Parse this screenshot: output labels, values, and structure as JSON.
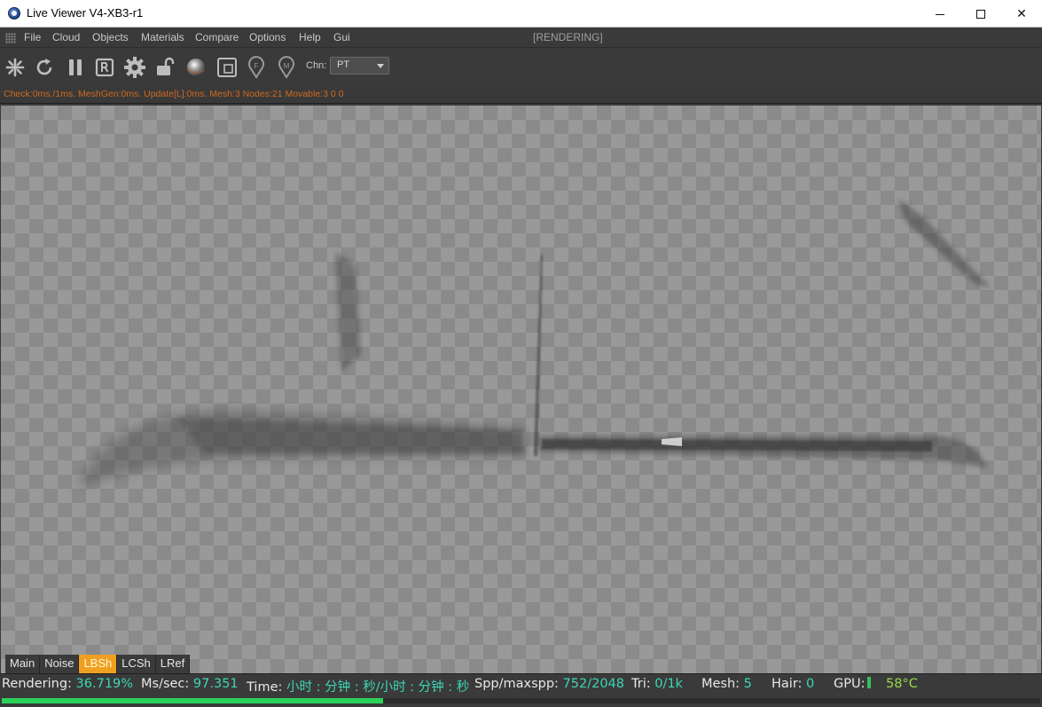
{
  "window": {
    "title": "Live Viewer V4-XB3-r1",
    "controls": {
      "minimize_icon": "minimize-icon",
      "maximize_icon": "maximize-icon",
      "close_glyph": "✕"
    }
  },
  "menu": {
    "items": [
      "File",
      "Cloud",
      "Objects",
      "Materials",
      "Compare",
      "Options",
      "Help",
      "Gui"
    ],
    "status": "[RENDERING]"
  },
  "toolbar": {
    "icons": [
      "send-scene-icon",
      "restart-icon",
      "pause-icon",
      "region-render-icon",
      "settings-gear-icon",
      "lock-icon",
      "material-ball-icon",
      "film-region-icon",
      "focus-pick-icon",
      "material-pick-icon"
    ],
    "channel_label": "Chn:",
    "channel_value": "PT"
  },
  "stats_line": "Check:0ms./1ms. MeshGen:0ms. Update[L]:0ms. Mesh:3 Nodes:21 Movable:3  0 0",
  "tabs": [
    {
      "label": "Main",
      "active": false
    },
    {
      "label": "Noise",
      "active": false
    },
    {
      "label": "LBSh",
      "active": true
    },
    {
      "label": "LCSh",
      "active": false
    },
    {
      "label": "LRef",
      "active": false
    }
  ],
  "status": {
    "rendering_label": "Rendering:",
    "rendering_value": "36.719%",
    "mssec_label": "Ms/sec:",
    "mssec_value": "97.351",
    "time_label": "Time:",
    "time_value": "小时 : 分钟 : 秒/小时 : 分钟 : 秒",
    "spp_label": "Spp/maxspp:",
    "spp_value": "752/2048",
    "tri_label": "Tri:",
    "tri_value": "0/1k",
    "mesh_label": "Mesh:",
    "mesh_value": "5",
    "hair_label": "Hair:",
    "hair_value": "0",
    "gpu_label": "GPU:",
    "gpu_temp": "58°C",
    "progress": 0.36719
  },
  "colors": {
    "accent_tab": "#f0a020",
    "value_text": "#3dd6b4",
    "progress": "#2ad25a",
    "stats_text": "#d2691e"
  }
}
